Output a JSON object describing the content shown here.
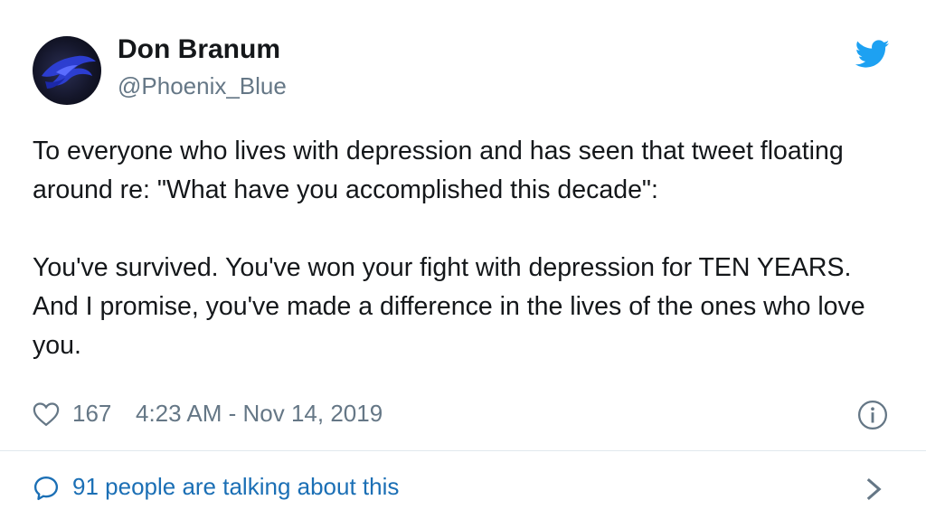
{
  "author": {
    "name": "Don Branum",
    "handle": "@Phoenix_Blue",
    "avatar_icon": "blue-phoenix-avatar"
  },
  "brand": {
    "icon": "twitter-bird-icon",
    "color": "#1da1f2"
  },
  "tweet": {
    "paragraph_1": "To everyone who lives with depression and has seen that tweet floating around re: \"What have you accomplished this decade\":",
    "paragraph_2": "You've survived. You've won your fight with depression for TEN YEARS. And I promise, you've made a difference in the lives of the ones who love you."
  },
  "meta": {
    "like_icon": "heart-icon",
    "like_count": "167",
    "timestamp": "4:23 AM - Nov 14, 2019",
    "info_icon": "info-icon"
  },
  "conversation": {
    "icon": "speech-bubble-icon",
    "text": "91 people are talking about this",
    "link_color": "#1b6fb5",
    "chevron_icon": "chevron-right-icon"
  },
  "colors": {
    "text_primary": "#14171a",
    "text_secondary": "#657786",
    "divider": "#e1e8ed"
  }
}
